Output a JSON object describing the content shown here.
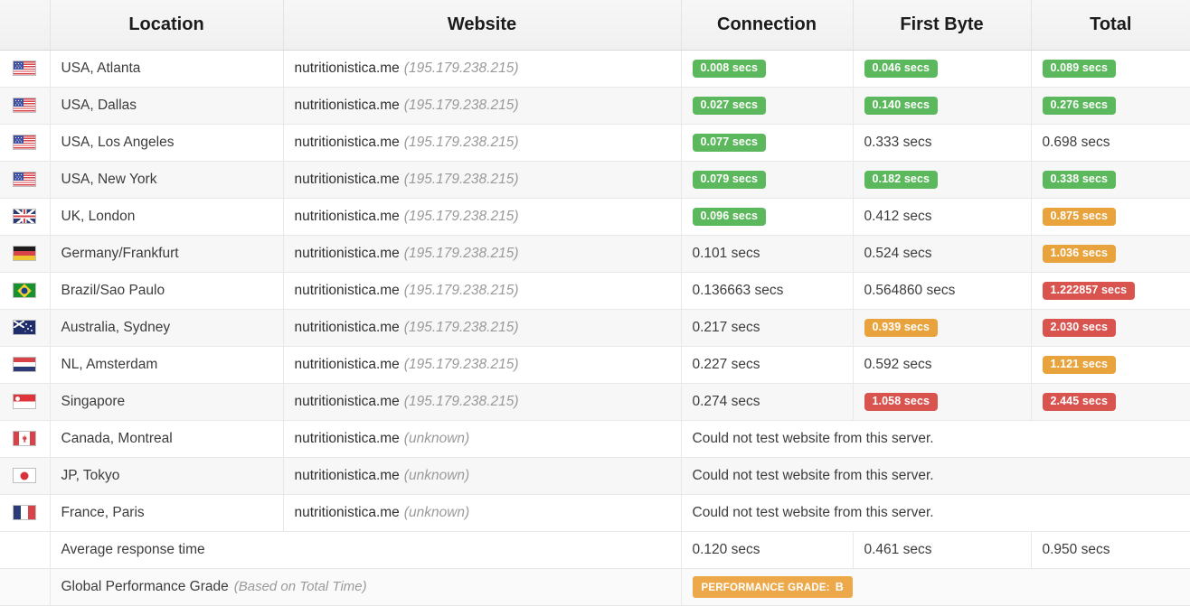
{
  "table": {
    "columns": [
      {
        "key": "flag",
        "label": ""
      },
      {
        "key": "location",
        "label": "Location"
      },
      {
        "key": "website",
        "label": "Website"
      },
      {
        "key": "connection",
        "label": "Connection"
      },
      {
        "key": "firstbyte",
        "label": "First Byte"
      },
      {
        "key": "total",
        "label": "Total"
      }
    ],
    "rows": [
      {
        "flag": "flag-us-icon",
        "flag_class": "flag-us",
        "location": "USA, Atlanta",
        "host": "nutritionistica.me",
        "ip": "(195.179.238.215)",
        "connection": {
          "text": "0.008 secs",
          "style": "green"
        },
        "firstbyte": {
          "text": "0.046 secs",
          "style": "green"
        },
        "total": {
          "text": "0.089 secs",
          "style": "green"
        }
      },
      {
        "flag": "flag-us-icon",
        "flag_class": "flag-us",
        "location": "USA, Dallas",
        "host": "nutritionistica.me",
        "ip": "(195.179.238.215)",
        "connection": {
          "text": "0.027 secs",
          "style": "green"
        },
        "firstbyte": {
          "text": "0.140 secs",
          "style": "green"
        },
        "total": {
          "text": "0.276 secs",
          "style": "green"
        }
      },
      {
        "flag": "flag-us-icon",
        "flag_class": "flag-us",
        "location": "USA, Los Angeles",
        "host": "nutritionistica.me",
        "ip": "(195.179.238.215)",
        "connection": {
          "text": "0.077 secs",
          "style": "green"
        },
        "firstbyte": {
          "text": "0.333 secs",
          "style": "plain"
        },
        "total": {
          "text": "0.698 secs",
          "style": "plain"
        }
      },
      {
        "flag": "flag-us-icon",
        "flag_class": "flag-us",
        "location": "USA, New York",
        "host": "nutritionistica.me",
        "ip": "(195.179.238.215)",
        "connection": {
          "text": "0.079 secs",
          "style": "green"
        },
        "firstbyte": {
          "text": "0.182 secs",
          "style": "green"
        },
        "total": {
          "text": "0.338 secs",
          "style": "green"
        }
      },
      {
        "flag": "flag-uk-icon",
        "flag_class": "flag-uk",
        "location": "UK, London",
        "host": "nutritionistica.me",
        "ip": "(195.179.238.215)",
        "connection": {
          "text": "0.096 secs",
          "style": "green"
        },
        "firstbyte": {
          "text": "0.412 secs",
          "style": "plain"
        },
        "total": {
          "text": "0.875 secs",
          "style": "orange"
        }
      },
      {
        "flag": "flag-de-icon",
        "flag_class": "flag-de",
        "location": "Germany/Frankfurt",
        "host": "nutritionistica.me",
        "ip": "(195.179.238.215)",
        "connection": {
          "text": "0.101 secs",
          "style": "plain"
        },
        "firstbyte": {
          "text": "0.524 secs",
          "style": "plain"
        },
        "total": {
          "text": "1.036 secs",
          "style": "orange"
        }
      },
      {
        "flag": "flag-br-icon",
        "flag_class": "flag-br",
        "location": "Brazil/Sao Paulo",
        "host": "nutritionistica.me",
        "ip": "(195.179.238.215)",
        "connection": {
          "text": "0.136663 secs",
          "style": "plain"
        },
        "firstbyte": {
          "text": "0.564860 secs",
          "style": "plain"
        },
        "total": {
          "text": "1.222857 secs",
          "style": "red"
        }
      },
      {
        "flag": "flag-au-icon",
        "flag_class": "flag-au",
        "location": "Australia, Sydney",
        "host": "nutritionistica.me",
        "ip": "(195.179.238.215)",
        "connection": {
          "text": "0.217 secs",
          "style": "plain"
        },
        "firstbyte": {
          "text": "0.939 secs",
          "style": "orange"
        },
        "total": {
          "text": "2.030 secs",
          "style": "red"
        }
      },
      {
        "flag": "flag-nl-icon",
        "flag_class": "flag-nl",
        "location": "NL, Amsterdam",
        "host": "nutritionistica.me",
        "ip": "(195.179.238.215)",
        "connection": {
          "text": "0.227 secs",
          "style": "plain"
        },
        "firstbyte": {
          "text": "0.592 secs",
          "style": "plain"
        },
        "total": {
          "text": "1.121 secs",
          "style": "orange"
        }
      },
      {
        "flag": "flag-sg-icon",
        "flag_class": "flag-sg",
        "location": "Singapore",
        "host": "nutritionistica.me",
        "ip": "(195.179.238.215)",
        "connection": {
          "text": "0.274 secs",
          "style": "plain"
        },
        "firstbyte": {
          "text": "1.058 secs",
          "style": "red"
        },
        "total": {
          "text": "2.445 secs",
          "style": "red"
        }
      },
      {
        "flag": "flag-ca-icon",
        "flag_class": "flag-ca",
        "location": "Canada, Montreal",
        "host": "nutritionistica.me",
        "ip": "(unknown)",
        "error": "Could not test website from this server."
      },
      {
        "flag": "flag-jp-icon",
        "flag_class": "flag-jp",
        "location": "JP, Tokyo",
        "host": "nutritionistica.me",
        "ip": "(unknown)",
        "error": "Could not test website from this server."
      },
      {
        "flag": "flag-fr-icon",
        "flag_class": "flag-fr",
        "location": "France, Paris",
        "host": "nutritionistica.me",
        "ip": "(unknown)",
        "error": "Could not test website from this server."
      }
    ],
    "footer": {
      "average_label": "Average response time",
      "average": {
        "connection": "0.120 secs",
        "firstbyte": "0.461 secs",
        "total": "0.950 secs"
      },
      "grade_label": "Global Performance Grade",
      "grade_note": "(Based on Total Time)",
      "grade_badge_label": "PERFORMANCE GRADE:",
      "grade_badge_value": "B"
    }
  },
  "colors": {
    "green": "#5cb85c",
    "orange": "#e8a33d",
    "red": "#d9534f",
    "grade": "#eda84a"
  }
}
